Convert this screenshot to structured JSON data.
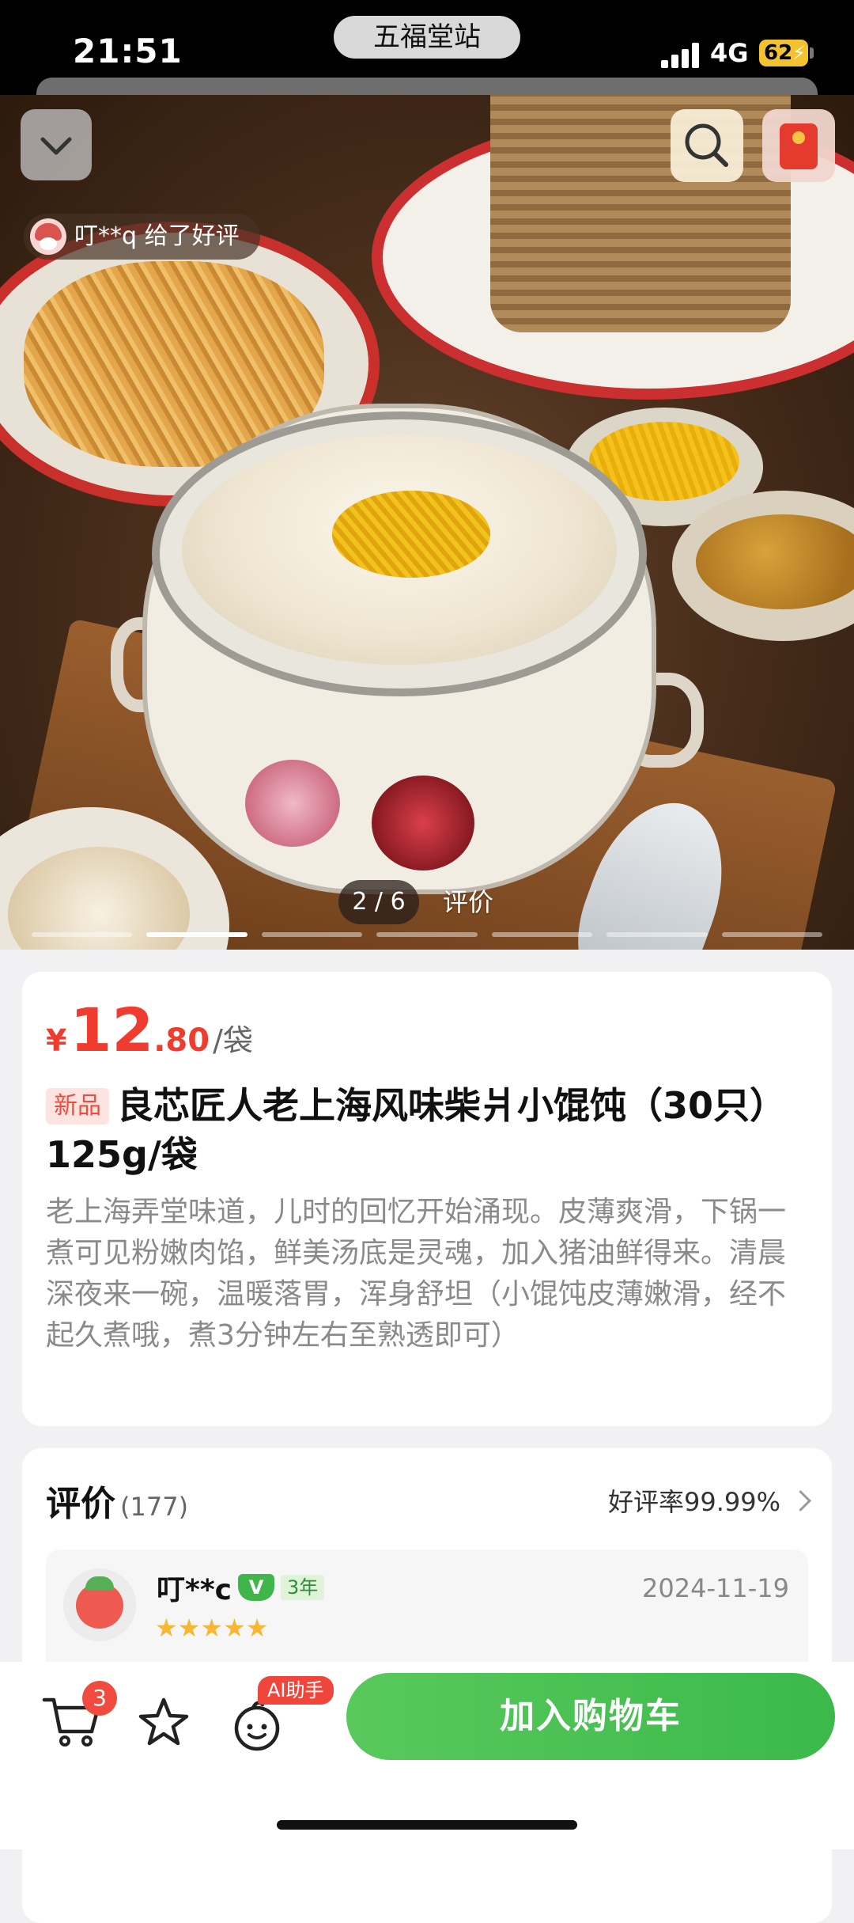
{
  "status_bar": {
    "time": "21:51",
    "station": "五福堂站",
    "network": "4G",
    "battery": "62"
  },
  "hero": {
    "review_chip_text": "叮**q 给了好评",
    "page_indicator": "2 / 6",
    "indicator_label": "评价",
    "image_count": 6,
    "active_image": 2,
    "icons": [
      "chevron-down-icon",
      "search-icon",
      "red-packet-icon"
    ]
  },
  "product": {
    "currency": "¥",
    "price_int": "12",
    "price_dec": ".80",
    "price_unit": "/袋",
    "badge": "新品",
    "title": "良芯匠人老上海风味柴爿小馄饨（30只）125g/袋",
    "description": "老上海弄堂味道，儿时的回忆开始涌现。皮薄爽滑，下锅一煮可见粉嫩肉馅，鲜美汤底是灵魂，加入猪油鲜得来。清晨深夜来一碗，温暖落胃，浑身舒坦（小馄饨皮薄嫩滑，经不起久煮哦，煮3分钟左右至熟透即可）"
  },
  "reviews": {
    "title": "评价",
    "count": "(177)",
    "rate": "好评率99.99%",
    "items": [
      {
        "user": "叮**c",
        "vip": "V",
        "years": "3年",
        "date": "2024-11-19",
        "stars": "★★★★★"
      }
    ]
  },
  "bottom_bar": {
    "cart_count": "3",
    "ai_badge": "AI助手",
    "add_to_cart": "加入购物车"
  },
  "colors": {
    "price_red": "#f03c2e",
    "cta_green": "#3bb94a",
    "star_yellow": "#f7b733"
  }
}
